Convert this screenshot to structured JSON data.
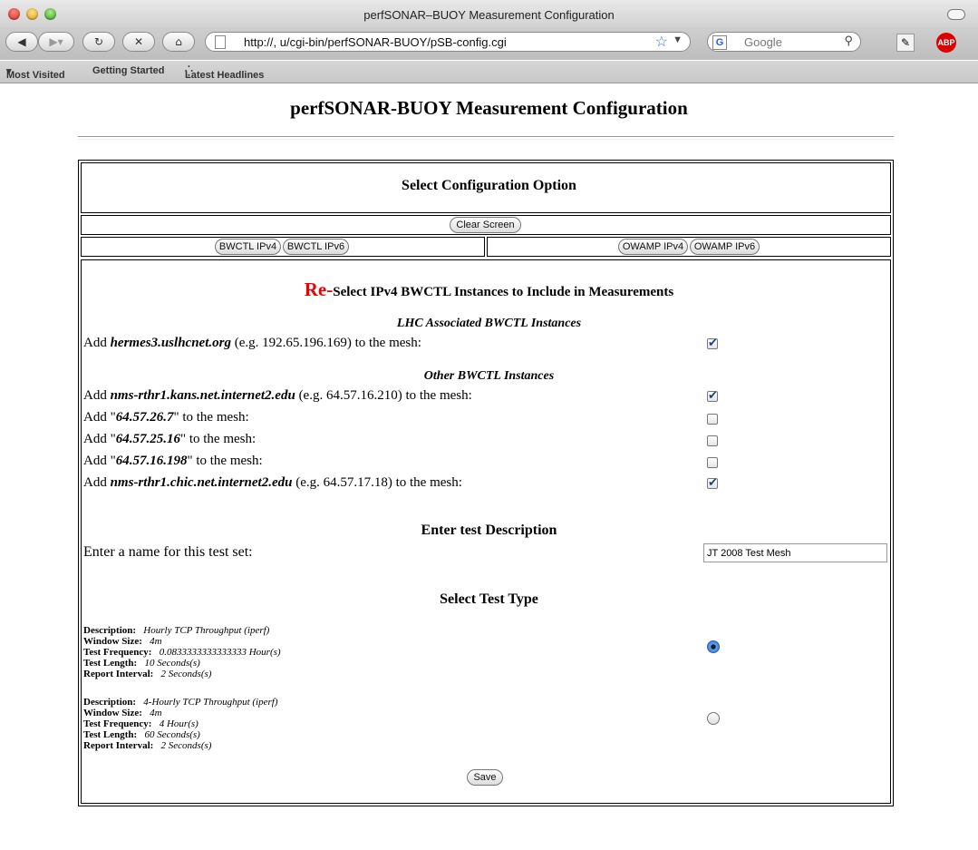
{
  "window": {
    "title": "perfSONAR–BUOY Measurement Configuration"
  },
  "toolbar": {
    "url": "http://,                    u/cgi-bin/perfSONAR-BUOY/pSB-config.cgi",
    "search_placeholder": "Google"
  },
  "bookmarks": [
    "Most Visited",
    "Getting Started",
    "Latest Headlines"
  ],
  "page": {
    "title": "perfSONAR-BUOY Measurement Configuration",
    "select_option_heading": "Select Configuration Option",
    "clear_screen": "Clear Screen",
    "bwctl_buttons": [
      "BWCTL IPv4",
      "BWCTL IPv6"
    ],
    "owamp_buttons": [
      "OWAMP IPv4",
      "OWAMP IPv6"
    ],
    "reselect_prefix": "Re-",
    "reselect_heading": "Select IPv4 BWCTL Instances to Include in Measurements",
    "lhc_heading": "LHC Associated BWCTL Instances",
    "other_heading": "Other BWCTL Instances",
    "rows": {
      "lhc": [
        {
          "pre": "Add ",
          "host": "hermes3.uslhcnet.org",
          "post": " (e.g. 192.65.196.169) to the mesh:",
          "checked": true
        }
      ],
      "other": [
        {
          "pre": "Add ",
          "host": "nms-rthr1.kans.net.internet2.edu",
          "post": " (e.g. 64.57.16.210) to the mesh:",
          "checked": true
        },
        {
          "pre": "Add \"",
          "host": "64.57.26.7",
          "post": "\" to the mesh:",
          "checked": false
        },
        {
          "pre": "Add \"",
          "host": "64.57.25.16",
          "post": "\" to the mesh:",
          "checked": false
        },
        {
          "pre": "Add \"",
          "host": "64.57.16.198",
          "post": "\" to the mesh:",
          "checked": false
        },
        {
          "pre": "Add ",
          "host": "nms-rthr1.chic.net.internet2.edu",
          "post": " (e.g. 64.57.17.18) to the mesh:",
          "checked": true
        }
      ]
    },
    "desc_heading": "Enter test Description",
    "name_label": "Enter a name for this test set:",
    "name_value": "JT 2008 Test Mesh",
    "type_heading": "Select Test Type",
    "tests": [
      {
        "labels": [
          "Description:",
          "Window Size:",
          "Test Frequency:",
          "Test Length:",
          "Report Interval:"
        ],
        "values": [
          "Hourly TCP Throughput (iperf)",
          "4m",
          "0.0833333333333333 Hour(s)",
          "10 Seconds(s)",
          "2 Seconds(s)"
        ],
        "selected": true
      },
      {
        "labels": [
          "Description:",
          "Window Size:",
          "Test Frequency:",
          "Test Length:",
          "Report Interval:"
        ],
        "values": [
          "4-Hourly TCP Throughput (iperf)",
          "4m",
          "4 Hour(s)",
          "60 Seconds(s)",
          "2 Seconds(s)"
        ],
        "selected": false
      }
    ],
    "save": "Save"
  }
}
